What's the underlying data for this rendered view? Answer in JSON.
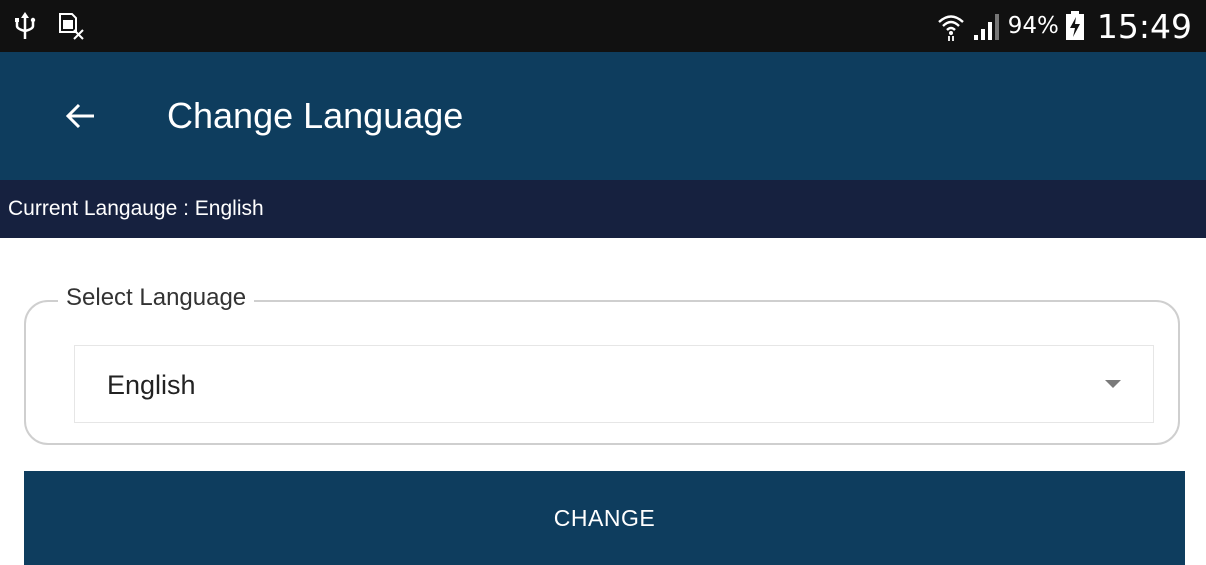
{
  "status_bar": {
    "left_icons": [
      "usb-icon",
      "no-sim-icon"
    ],
    "right_icons": [
      "wifi-icon",
      "signal-icon",
      "battery-charging-icon"
    ],
    "battery_percent": "94%",
    "time": "15:49"
  },
  "app_bar": {
    "back_icon": "arrow-left-icon",
    "title": "Change Language"
  },
  "current_language": {
    "text": "Current Langauge : English"
  },
  "language_field": {
    "legend": "Select Language",
    "selected_value": "English",
    "dropdown_icon": "dropdown-triangle-icon"
  },
  "actions": {
    "change_label": "CHANGE"
  },
  "colors": {
    "status_bar_bg": "#111111",
    "app_bar_bg": "#0e3d5e",
    "strip_bg": "#16213f",
    "button_bg": "#0e3d5e",
    "border": "#cfcfcf"
  }
}
